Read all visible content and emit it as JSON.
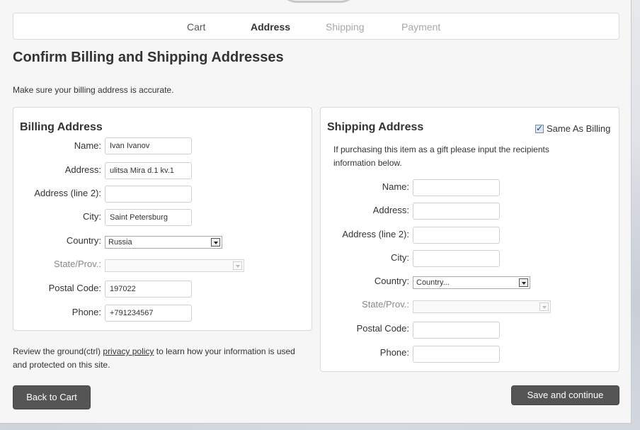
{
  "steps": [
    {
      "label": "Cart",
      "state": "done"
    },
    {
      "label": "Address",
      "state": "active"
    },
    {
      "label": "Shipping",
      "state": "future"
    },
    {
      "label": "Payment",
      "state": "future"
    }
  ],
  "page": {
    "title": "Confirm Billing and Shipping Addresses",
    "intro": "Make sure your billing address is accurate."
  },
  "billing": {
    "title": "Billing Address",
    "name_label": "Name:",
    "name_value": "Ivan Ivanov",
    "address_label": "Address:",
    "address_value": "ulitsa Mira d.1 kv.1",
    "address2_label": "Address (line 2):",
    "address2_value": "",
    "city_label": "City:",
    "city_value": "Saint Petersburg",
    "country_label": "Country:",
    "country_value": "Russia",
    "state_label": "State/Prov.:",
    "state_value": "",
    "postal_label": "Postal Code:",
    "postal_value": "197022",
    "phone_label": "Phone:",
    "phone_value": "+791234567"
  },
  "shipping": {
    "title": "Shipping Address",
    "same_as_billing_label": "Same As Billing",
    "same_as_billing_checked": true,
    "gift_note": "If purchasing this item as a gift please input the recipients information below.",
    "name_label": "Name:",
    "address_label": "Address:",
    "address2_label": "Address (line 2):",
    "city_label": "City:",
    "country_label": "Country:",
    "country_value": "Country...",
    "state_label": "State/Prov.:",
    "postal_label": "Postal Code:",
    "phone_label": "Phone:"
  },
  "privacy": {
    "before": "Review the ground(ctrl) ",
    "link": "privacy policy",
    "after": " to learn how your information is used and protected on this site."
  },
  "buttons": {
    "back": "Back to Cart",
    "save": "Save and continue"
  }
}
